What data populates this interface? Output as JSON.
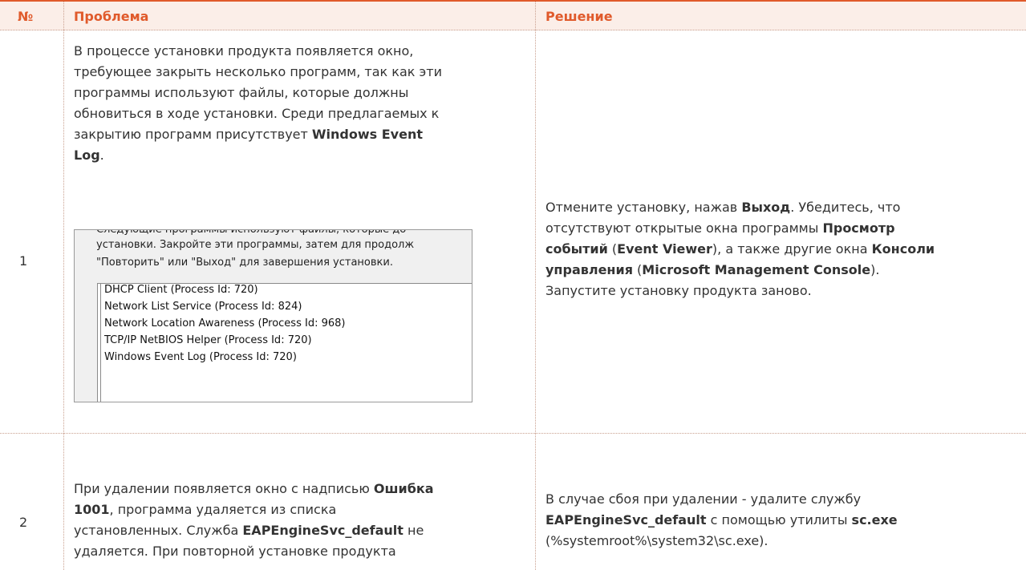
{
  "header": {
    "num": "№",
    "problem": "Проблема",
    "solution": "Решение"
  },
  "rows": [
    {
      "num": "1",
      "problem": {
        "lines": [
          "В процессе установки продукта появляется окно,",
          "требующее закрыть несколько программ, так как эти",
          "программы используют файлы, которые должны",
          "обновиться в ходе установки. Среди предлагаемых к",
          "закрытию программ присутствует "
        ],
        "bold1": "Windows Event",
        "bold2": "Log",
        "tail": "."
      },
      "dialog": {
        "line1": "Следующие программы используют файлы, которые до",
        "line2": "установки. Закройте эти программы, затем для продолж",
        "line3": "\"Повторить\" или \"Выход\" для завершения установки.",
        "items": [
          "DHCP Client (Process Id: 720)",
          "Network List Service (Process Id: 824)",
          "Network Location Awareness (Process Id: 968)",
          "TCP/IP NetBIOS Helper (Process Id: 720)",
          "Windows Event Log (Process Id: 720)"
        ]
      },
      "solution": {
        "s1": "Отмените установку, нажав ",
        "b1": "Выход",
        "s2": ". Убедитесь, что",
        "s3": "отсутствуют открытые окна программы ",
        "b2": "Просмотр",
        "b3": "событий",
        "s4": " (",
        "b4": "Event Viewer",
        "s5": "), а также другие окна ",
        "b5": "Консоли",
        "b6": "управления",
        "s6": " (",
        "b7": "Microsoft Management Console",
        "s7": ").",
        "s8": "Запустите установку продукта заново."
      }
    },
    {
      "num": "2",
      "problem": {
        "p1": "При удалении появляется окно с надписью ",
        "b1": "Ошибка",
        "b2": "1001",
        "p2": ", программа удаляется из списка",
        "p3": "установленных. Служба ",
        "b3": "EAPEngineSvc_default",
        "p4": " не",
        "p5": "удаляется. При повторной установке продукта"
      },
      "solution": {
        "s1": "В случае сбоя при удалении - удалите службу",
        "b1": "EAPEngineSvc_default",
        "s2": " с помощью утилиты ",
        "b2": "sc.exe",
        "s3": "(%systemroot%\\system32\\sc.exe)."
      }
    }
  ]
}
